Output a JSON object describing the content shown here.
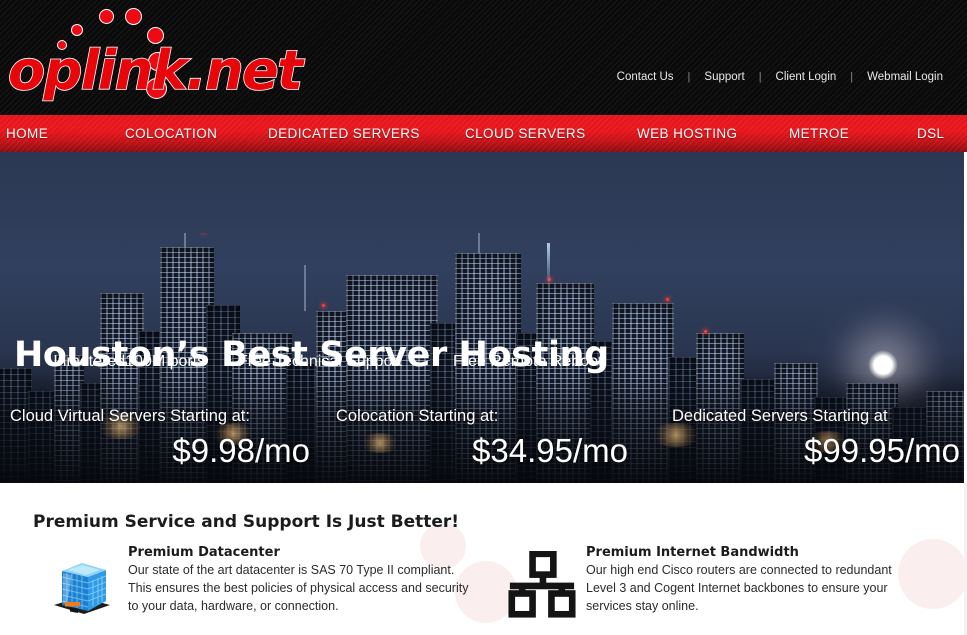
{
  "site": {
    "brand_name": "oplink.net",
    "brand_color": "#ee0a12",
    "nav_red": "#e4151b"
  },
  "header": {
    "logo_text": "oplink.net",
    "top_links": [
      {
        "label": "Contact Us"
      },
      {
        "label": "Support"
      },
      {
        "label": "Client Login"
      },
      {
        "label": "Webmail Login"
      }
    ],
    "separator": "|"
  },
  "nav": {
    "items": [
      {
        "label": "HOME"
      },
      {
        "label": "COLOCATION"
      },
      {
        "label": "DEDICATED SERVERS"
      },
      {
        "label": "CLOUD SERVERS"
      },
      {
        "label": "WEB HOSTING"
      },
      {
        "label": "METROE"
      },
      {
        "label": "DSL"
      }
    ]
  },
  "hero": {
    "title": "Houston’s Best Server Hosting",
    "taglines": [
      {
        "text": "Unmetered100M ports"
      },
      {
        "text": "Free Technical Support"
      },
      {
        "text": "Free Remote Reboot"
      }
    ],
    "pricing": [
      {
        "label": "Cloud Virtual Servers Starting at:",
        "value": "$9.98/mo"
      },
      {
        "label": "Colocation Starting at:",
        "value": "$34.95/mo"
      },
      {
        "label": "Dedicated Servers Starting at",
        "value": "$99.95/mo"
      }
    ]
  },
  "content": {
    "section_title": "Premium Service and Support Is Just Better!",
    "features": [
      {
        "icon": "datacenter-building-icon",
        "title": "Premium Datacenter",
        "body": "Our state of the art datacenter is SAS 70 Type II compliant. This ensures the best policies of physical access and security to your data, hardware, or connection."
      },
      {
        "icon": "network-topology-icon",
        "title": "Premium Internet Bandwidth",
        "body": "Our high end Cisco routers are connected to redundant Level 3 and Cogent Internet backbones to ensure your services stay online."
      }
    ]
  }
}
